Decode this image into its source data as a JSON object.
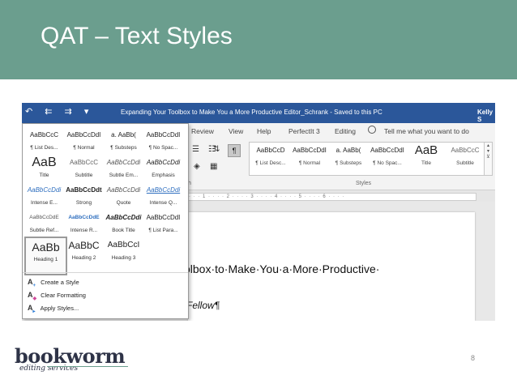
{
  "slide": {
    "title": "QAT – Text Styles",
    "page_number": "8",
    "accent_color": "#6b9e8e"
  },
  "word": {
    "qat_icons": "↶ ⇇ ⇉ ▾",
    "title_text": "Expanding Your Toolbox to Make You a More Productive Editor_Schrank  -  Saved to this PC",
    "user_text": "Kelly S",
    "menu": [
      "Review",
      "View",
      "Help",
      "PerfectIt 3",
      "Editing"
    ],
    "tell_me": "Tell me what you want to do",
    "ribbon_gallery": [
      {
        "sample": "AaBbCcD",
        "name": "¶ List Desc..."
      },
      {
        "sample": "AaBbCcDdI",
        "name": "¶ Normal"
      },
      {
        "sample": "a.  AaBb(",
        "name": "¶ Substeps"
      },
      {
        "sample": "AaBbCcDdI",
        "name": "¶ No Spac..."
      },
      {
        "sample": "AaB",
        "name": "Title"
      },
      {
        "sample": "AaBbCcC",
        "name": "Subtitle"
      }
    ],
    "group_styles_label": "Styles",
    "group_para_label": "h",
    "ruler_text": "·  ·  ·  1  ·  ·  ·  ·  2  ·  ·  ·  ·  3  ·  ·  ·  ·  4  ·  ·  ·  ·  5  ·  ·  ·  ·  6  ·  ·  ·  ·",
    "doc_line1": "olbox·to·Make·You·a·More·Productive·",
    "doc_line2": "Fellow¶",
    "styles_dropdown": {
      "rows": [
        [
          {
            "sample": "AaBbCcC",
            "name": "¶ List Des..."
          },
          {
            "sample": "AaBbCcDdI",
            "name": "¶ Normal"
          },
          {
            "sample": "a.  AaBb(",
            "name": "¶ Substeps"
          },
          {
            "sample": "AaBbCcDdI",
            "name": "¶ No Spac..."
          }
        ],
        [
          {
            "sample": "AaB",
            "name": "Title"
          },
          {
            "sample": "AaBbCcC",
            "name": "Subtitle"
          },
          {
            "sample": "AaBbCcDdi",
            "name": "Subtle Em..."
          },
          {
            "sample": "AaBbCcDdi",
            "name": "Emphasis"
          }
        ],
        [
          {
            "sample": "AaBbCcDdi",
            "name": "Intense E..."
          },
          {
            "sample": "AaBbCcDdt",
            "name": "Strong"
          },
          {
            "sample": "AaBbCcDdi",
            "name": "Quote"
          },
          {
            "sample": "AaBbCcDdi",
            "name": "Intense Q..."
          }
        ],
        [
          {
            "sample": "AaBbCcDdE",
            "name": "Subtle Ref..."
          },
          {
            "sample": "AaBbCcDdE",
            "name": "Intense R..."
          },
          {
            "sample": "AaBbCcDdi",
            "name": "Book Title"
          },
          {
            "sample": "AaBbCcDdI",
            "name": "¶ List Para..."
          }
        ],
        [
          {
            "sample": "AaBb",
            "name": "Heading 1"
          },
          {
            "sample": "AaBbC",
            "name": "Heading 2"
          },
          {
            "sample": "AaBbCcI",
            "name": "Heading 3"
          }
        ]
      ],
      "actions": [
        {
          "icon": "A",
          "label": "Create a Style"
        },
        {
          "icon": "A",
          "label": "Clear Formatting"
        },
        {
          "icon": "A",
          "label": "Apply Styles..."
        }
      ]
    }
  },
  "logo": {
    "main": "bookworm",
    "sub": "editing services"
  }
}
